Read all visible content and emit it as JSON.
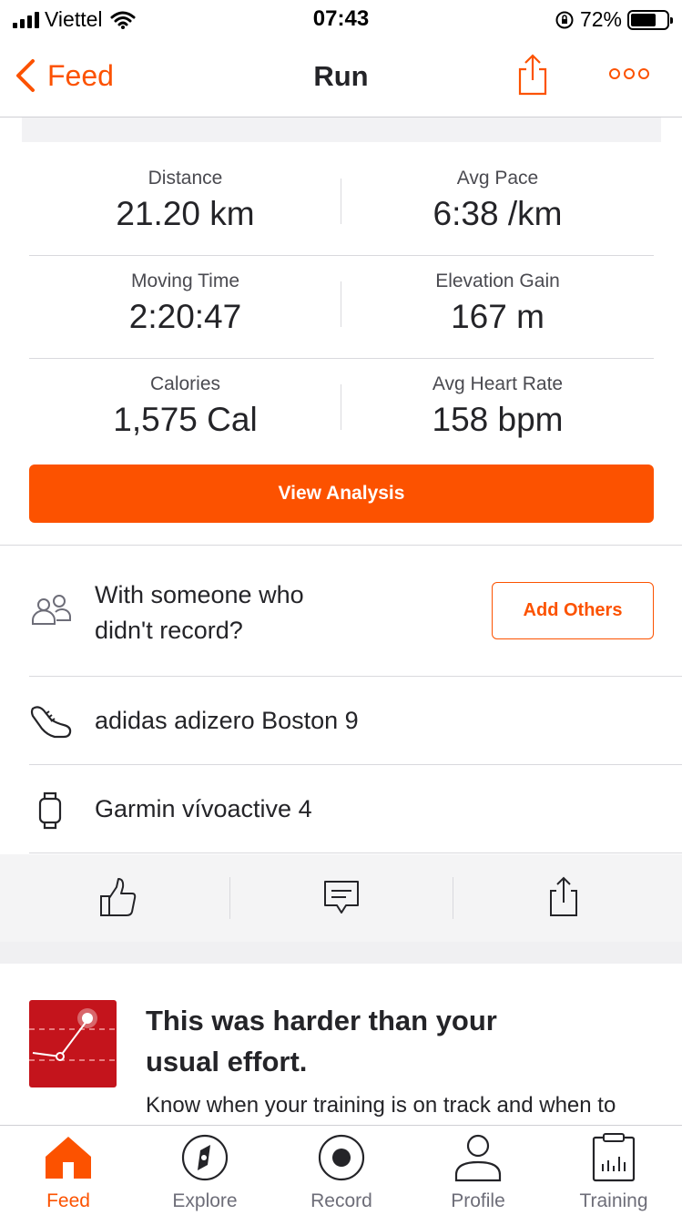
{
  "status_bar": {
    "carrier": "Viettel",
    "time": "07:43",
    "battery": "72%"
  },
  "nav": {
    "back_label": "Feed",
    "title": "Run"
  },
  "stats": [
    [
      {
        "label": "Distance",
        "value": "21.20 km"
      },
      {
        "label": "Avg Pace",
        "value": "6:38 /km"
      }
    ],
    [
      {
        "label": "Moving Time",
        "value": "2:20:47"
      },
      {
        "label": "Elevation Gain",
        "value": "167 m"
      }
    ],
    [
      {
        "label": "Calories",
        "value": "1,575 Cal"
      },
      {
        "label": "Avg Heart Rate",
        "value": "158 bpm"
      }
    ]
  ],
  "analysis_button": "View Analysis",
  "with_others": {
    "line1": "With someone who",
    "line2": "didn't record?",
    "button": "Add Others"
  },
  "gear": {
    "shoes": "adidas adizero Boston 9",
    "device": "Garmin vívoactive 4"
  },
  "insight": {
    "title_line1": "This was harder than your",
    "title_line2": "usual effort.",
    "body": "Know when your training is on track and when to"
  },
  "tabs": [
    {
      "label": "Feed",
      "icon": "home-icon",
      "active": true
    },
    {
      "label": "Explore",
      "icon": "compass-icon",
      "active": false
    },
    {
      "label": "Record",
      "icon": "record-icon",
      "active": false
    },
    {
      "label": "Profile",
      "icon": "profile-icon",
      "active": false
    },
    {
      "label": "Training",
      "icon": "training-icon",
      "active": false
    }
  ],
  "colors": {
    "accent": "#fc5200",
    "text": "#242428",
    "muted": "#6d6d78"
  }
}
